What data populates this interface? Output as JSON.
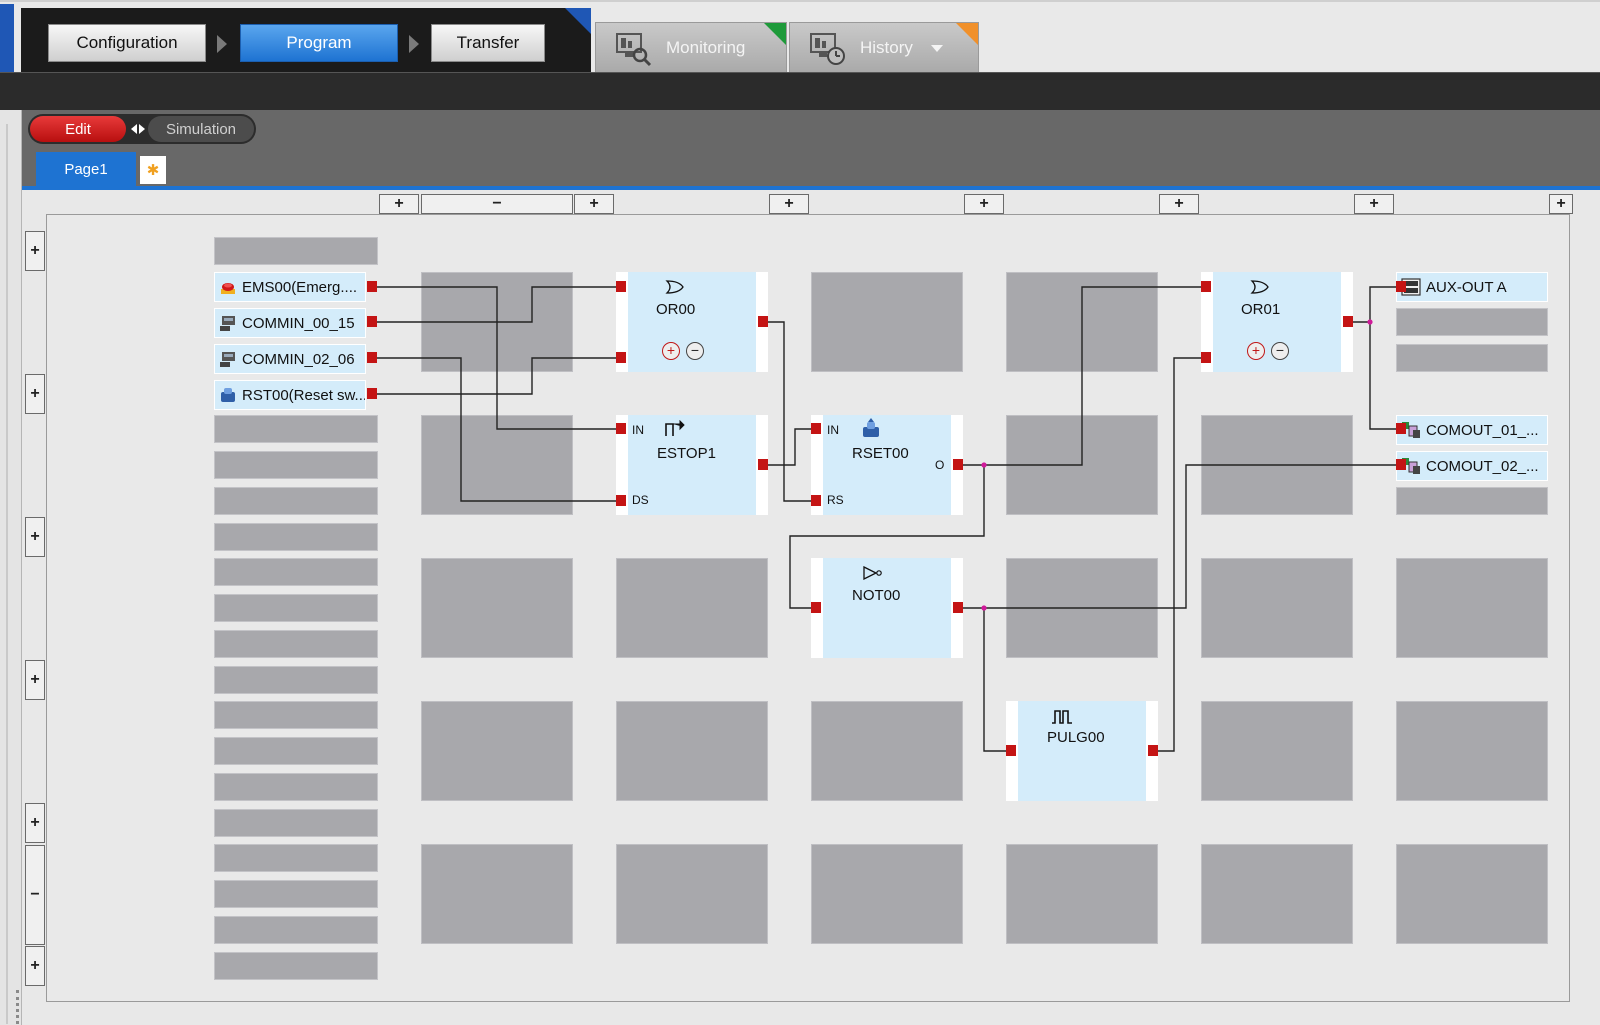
{
  "nav": {
    "configuration": "Configuration",
    "program": "Program",
    "transfer": "Transfer",
    "monitoring": "Monitoring",
    "history": "History"
  },
  "mode": {
    "edit": "Edit",
    "simulation": "Simulation"
  },
  "page": {
    "tab": "Page1",
    "new_page_glyph": "✱"
  },
  "canvas_controls": {
    "add": "+",
    "remove": "−"
  },
  "inputs": {
    "ems00": "EMS00(Emerg....",
    "commin_00_15": "COMMIN_00_15",
    "commin_02_06": "COMMIN_02_06",
    "rst00": "RST00(Reset sw..."
  },
  "blocks": {
    "or00": {
      "name": "OR00",
      "add": "+",
      "remove": "−"
    },
    "or01": {
      "name": "OR01",
      "add": "+",
      "remove": "−"
    },
    "estop1": {
      "name": "ESTOP1",
      "in": "IN",
      "ds": "DS"
    },
    "rset00": {
      "name": "RSET00",
      "in": "IN",
      "rs": "RS",
      "o": "O"
    },
    "not00": {
      "name": "NOT00"
    },
    "pulg00": {
      "name": "PULG00"
    }
  },
  "outputs": {
    "aux_out_a": "AUX-OUT A",
    "comout_01": "COMOUT_01_...",
    "comout_02": "COMOUT_02_..."
  },
  "colors": {
    "accent": "#1e73d2",
    "edit_red": "#c41414",
    "port_red": "#c41414",
    "monitoring_tag": "#1e9a3a",
    "history_tag": "#f0902a",
    "block_fill": "#d4ecfa",
    "empty_slot": "#a8a8ac",
    "wire": "#222222",
    "junction": "#d01a9a"
  },
  "icons": {
    "monitoring": "monitor-search-icon",
    "history": "monitor-clock-icon",
    "ems00": "emergency-stop-icon",
    "commin": "com-input-icon",
    "rst00": "reset-switch-icon",
    "estop": "estop-icon",
    "rset": "reset-icon",
    "or": "or-gate-icon",
    "not": "not-gate-icon",
    "pulg": "pulse-icon",
    "aux_out": "aux-out-icon",
    "comout": "com-output-icon"
  }
}
